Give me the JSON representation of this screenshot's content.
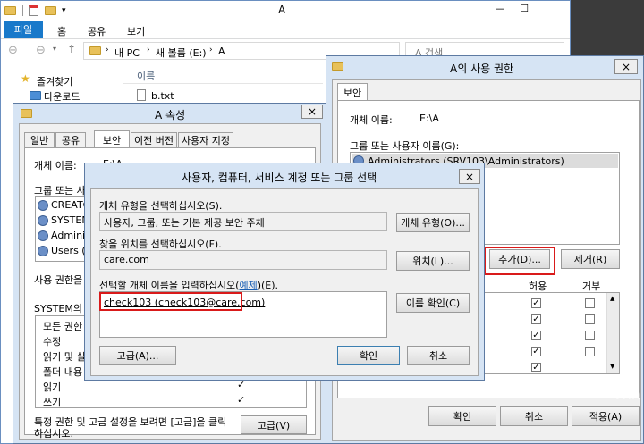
{
  "explorer": {
    "title": "A",
    "ribbon_tabs": [
      "파일",
      "홈",
      "공유",
      "보기"
    ],
    "breadcrumb": [
      "내 PC",
      "새 볼륨 (E:)",
      "A"
    ],
    "search_placeholder": "A 검색",
    "nav": {
      "favorites": "즐겨찾기",
      "downloads": "다운로드"
    },
    "column_name": "이름",
    "files": [
      "b.txt"
    ]
  },
  "props": {
    "title": "A 속성",
    "tabs": [
      "일반",
      "공유",
      "보안",
      "이전 버전",
      "사용자 지정"
    ],
    "object_name_label": "개체 이름:",
    "object_name": "E:\\A",
    "group_label": "그룹 또는 사",
    "users": [
      "CREATO",
      "SYSTEM",
      "Adminis",
      "Users (S"
    ],
    "change_label": "사용 권한을",
    "perm_label": "SYSTEM의 사",
    "perms": [
      "모든 권한",
      "수정",
      "읽기 및 실",
      "폴더 내용",
      "읽기",
      "쓰기"
    ],
    "perm_checks": [
      "",
      "",
      "",
      "",
      "✓",
      "✓"
    ],
    "footer_text_1": "특정 권한 및 고급 설정을 보려면 [고급]을 클릭",
    "footer_text_2": "하십시오.",
    "advanced_btn": "고급(V)"
  },
  "perm_dialog": {
    "title": "A의 사용 권한",
    "tab": "보안",
    "object_label": "개체 이름:",
    "object_name": "E:\\A",
    "group_label": "그룹 또는 사용자 이름(G):",
    "users": [
      "Administrators (SRV103\\Administrators)"
    ],
    "add_btn": "추가(D)...",
    "remove_btn": "제거(R)",
    "allow_label": "허용",
    "deny_label": "거부",
    "allow_checks": [
      "✓",
      "✓",
      "✓",
      "✓",
      "✓"
    ],
    "ok_btn": "확인",
    "cancel_btn": "취소",
    "apply_btn": "적용(A)"
  },
  "select_dialog": {
    "title": "사용자, 컴퓨터, 서비스 계정 또는 그룹 선택",
    "type_label": "개체 유형을 선택하십시오(S).",
    "type_value": "사용자, 그룹, 또는 기본 제공 보안 주체",
    "type_btn": "개체 유형(O)...",
    "location_label": "찾을 위치를 선택하십시오(F).",
    "location_value": "care.com",
    "location_btn": "위치(L)...",
    "names_label_pre": "선택할 개체 이름을 입력하십시오(",
    "names_label_link": "예제",
    "names_label_post": ")(E).",
    "names_value": "check103 (check103@care.com)",
    "check_btn": "이름 확인(C)",
    "advanced_btn": "고급(A)...",
    "ok_btn": "확인",
    "cancel_btn": "취소"
  },
  "watermark": "Win"
}
